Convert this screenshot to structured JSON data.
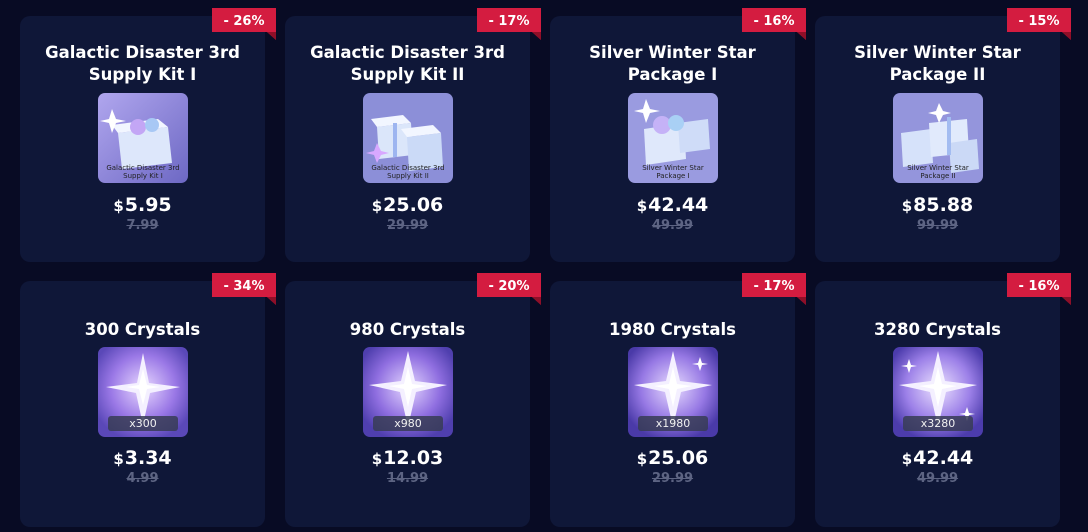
{
  "colors": {
    "background": "#080b24",
    "card": "#0f1738",
    "ribbon": "#d41c40",
    "old_price": "#5d6483"
  },
  "currency_symbol": "$",
  "items": [
    {
      "title": "Galactic Disaster 3rd Supply Kit I",
      "discount": "- 26%",
      "price": "5.95",
      "old_price": "7.99",
      "image_caption": "Galactic Disaster 3rd Supply Kit I",
      "icon": "gift-box-icon"
    },
    {
      "title": "Galactic Disaster 3rd Supply Kit II",
      "discount": "- 17%",
      "price": "25.06",
      "old_price": "29.99",
      "image_caption": "Galactic Disaster 3rd Supply Kit II",
      "icon": "gift-box-icon"
    },
    {
      "title": "Silver Winter Star Package I",
      "discount": "- 16%",
      "price": "42.44",
      "old_price": "49.99",
      "image_caption": "Silver Winter Star Package I",
      "icon": "gift-box-icon"
    },
    {
      "title": "Silver Winter Star Package II",
      "discount": "- 15%",
      "price": "85.88",
      "old_price": "99.99",
      "image_caption": "Silver Winter Star Package II",
      "icon": "gift-box-icon"
    },
    {
      "title": "300 Crystals",
      "discount": "- 34%",
      "price": "3.34",
      "old_price": "4.99",
      "quantity": "x300",
      "icon": "crystal-icon"
    },
    {
      "title": "980 Crystals",
      "discount": "- 20%",
      "price": "12.03",
      "old_price": "14.99",
      "quantity": "x980",
      "icon": "crystal-icon"
    },
    {
      "title": "1980 Crystals",
      "discount": "- 17%",
      "price": "25.06",
      "old_price": "29.99",
      "quantity": "x1980",
      "icon": "crystal-icon"
    },
    {
      "title": "3280 Crystals",
      "discount": "- 16%",
      "price": "42.44",
      "old_price": "49.99",
      "quantity": "x3280",
      "icon": "crystal-icon"
    }
  ]
}
